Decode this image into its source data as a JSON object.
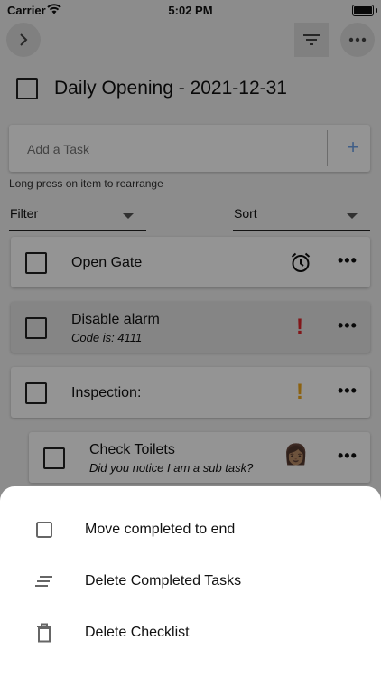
{
  "status": {
    "carrier": "Carrier",
    "time": "5:02 PM"
  },
  "header": {
    "title": "Daily Opening - 2021-12-31"
  },
  "add_task": {
    "placeholder": "Add a Task",
    "button": "+"
  },
  "hint": "Long press on item to rearrange",
  "filters": {
    "filter_label": "Filter",
    "sort_label": "Sort"
  },
  "tasks": [
    {
      "name": "Open Gate",
      "note": "",
      "icon": "alarm-clock-icon",
      "menu": "•••"
    },
    {
      "name": "Disable alarm",
      "note": "Code is: 4111",
      "icon": "priority-high-icon",
      "icon_glyph": "!",
      "icon_color": "#e0262b",
      "menu": "•••"
    },
    {
      "name": "Inspection:",
      "note": "",
      "icon": "priority-medium-icon",
      "icon_glyph": "!",
      "icon_color": "#f2a91c",
      "menu": "•••"
    },
    {
      "name": "Check Toilets",
      "note": "Did you notice I am a sub task?",
      "icon": "person-icon",
      "icon_glyph": "👩🏽",
      "menu": "•••"
    }
  ],
  "sheet": {
    "items": [
      {
        "label": "Move completed to end",
        "icon": "checkbox-icon"
      },
      {
        "label": "Delete Completed Tasks",
        "icon": "clear-lines-icon"
      },
      {
        "label": "Delete Checklist",
        "icon": "trash-icon"
      }
    ]
  },
  "colors": {
    "accent": "#6fa3e8",
    "priority_high": "#e0262b",
    "priority_medium": "#f2a91c"
  }
}
